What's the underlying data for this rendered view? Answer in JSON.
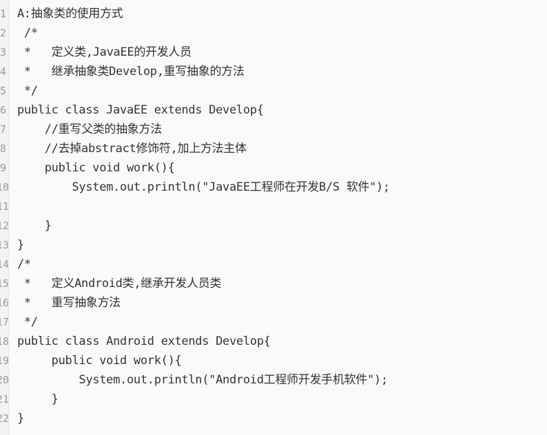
{
  "code_viewer": {
    "lines": [
      {
        "num": "1",
        "text": "A:抽象类的使用方式"
      },
      {
        "num": "2",
        "text": " /*"
      },
      {
        "num": "3",
        "text": " *   定义类,JavaEE的开发人员"
      },
      {
        "num": "4",
        "text": " *   继承抽象类Develop,重写抽象的方法"
      },
      {
        "num": "5",
        "text": " */"
      },
      {
        "num": "6",
        "text": "public class JavaEE extends Develop{"
      },
      {
        "num": "7",
        "text": "    //重写父类的抽象方法"
      },
      {
        "num": "8",
        "text": "    //去掉abstract修饰符,加上方法主体"
      },
      {
        "num": "9",
        "text": "    public void work(){"
      },
      {
        "num": "10",
        "text": "        System.out.println(\"JavaEE工程师在开发B/S 软件\");"
      },
      {
        "num": "11",
        "text": ""
      },
      {
        "num": "12",
        "text": "    }"
      },
      {
        "num": "13",
        "text": "}"
      },
      {
        "num": "14",
        "text": "/*"
      },
      {
        "num": "15",
        "text": " *   定义Android类,继承开发人员类"
      },
      {
        "num": "16",
        "text": " *   重写抽象方法"
      },
      {
        "num": "17",
        "text": " */"
      },
      {
        "num": "18",
        "text": "public class Android extends Develop{"
      },
      {
        "num": "19",
        "text": "     public void work(){"
      },
      {
        "num": "20",
        "text": "         System.out.println(\"Android工程师开发手机软件\");"
      },
      {
        "num": "21",
        "text": "     }"
      },
      {
        "num": "22",
        "text": "}"
      }
    ]
  }
}
